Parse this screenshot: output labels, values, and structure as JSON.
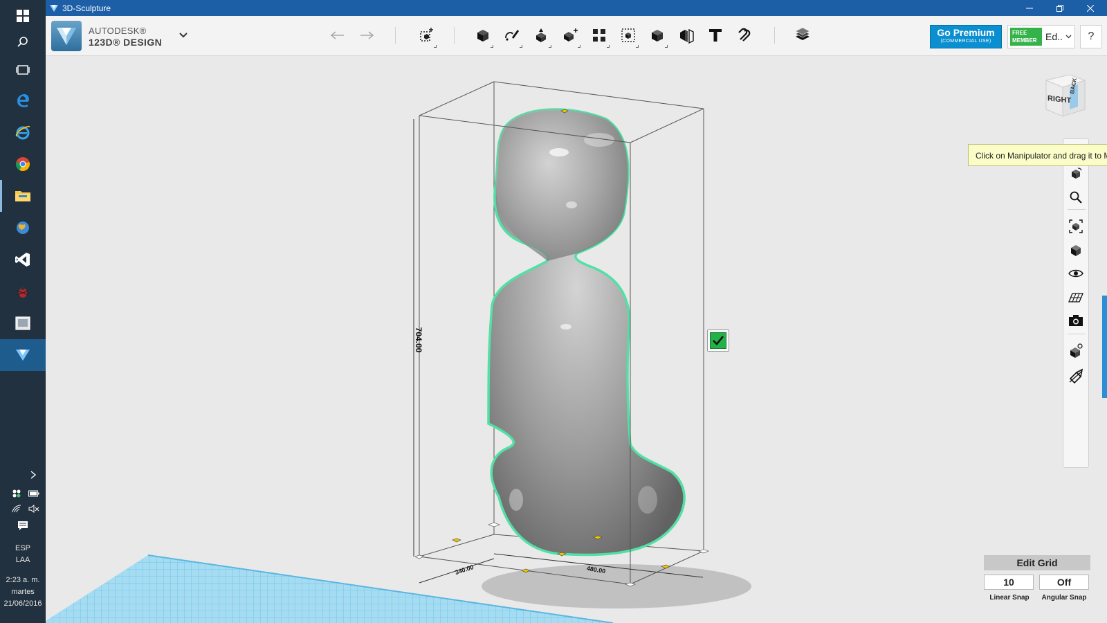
{
  "window": {
    "title": "3D-Sculpture"
  },
  "brand": {
    "line1": "AUTODESK®",
    "line2": "123D® DESIGN"
  },
  "toolbar": {
    "tools": [
      {
        "name": "undo-icon"
      },
      {
        "name": "redo-icon"
      },
      {
        "name": "transform-icon"
      },
      {
        "name": "primitives-icon"
      },
      {
        "name": "sketch-icon"
      },
      {
        "name": "construct-icon"
      },
      {
        "name": "modify-icon"
      },
      {
        "name": "pattern-icon"
      },
      {
        "name": "grouping-icon"
      },
      {
        "name": "combine-icon"
      },
      {
        "name": "measure-icon"
      },
      {
        "name": "text-icon"
      },
      {
        "name": "snap-icon"
      },
      {
        "name": "material-icon"
      }
    ]
  },
  "account": {
    "premium_title": "Go Premium",
    "premium_sub": "(COMMERCIAL USE)",
    "badge_line1": "FREE",
    "badge_line2": "MEMBER",
    "user_name": "Ed..",
    "help_label": "?"
  },
  "viewcube": {
    "face_right": "RIGHT",
    "face_back": "BACK"
  },
  "tooltip": {
    "text": "Click on Manipulator and drag it to M"
  },
  "model": {
    "height_label": "704.00",
    "width_label": "340.00",
    "depth_label": "480.00"
  },
  "edit_grid": {
    "title": "Edit Grid",
    "linear_value": "10",
    "angular_value": "Off",
    "linear_label": "Linear Snap",
    "angular_label": "Angular Snap"
  },
  "taskbar": {
    "lang1": "ESP",
    "lang2": "LAA",
    "time": "2:23 a. m.",
    "day": "martes",
    "date": "21/06/2016"
  },
  "colors": {
    "titlebar": "#1d5fa6",
    "taskbar": "#22313f",
    "premium": "#0a8fd0",
    "free_badge": "#35b24a",
    "selection_outline": "#52e0a6",
    "grid": "#8fd3ef"
  }
}
